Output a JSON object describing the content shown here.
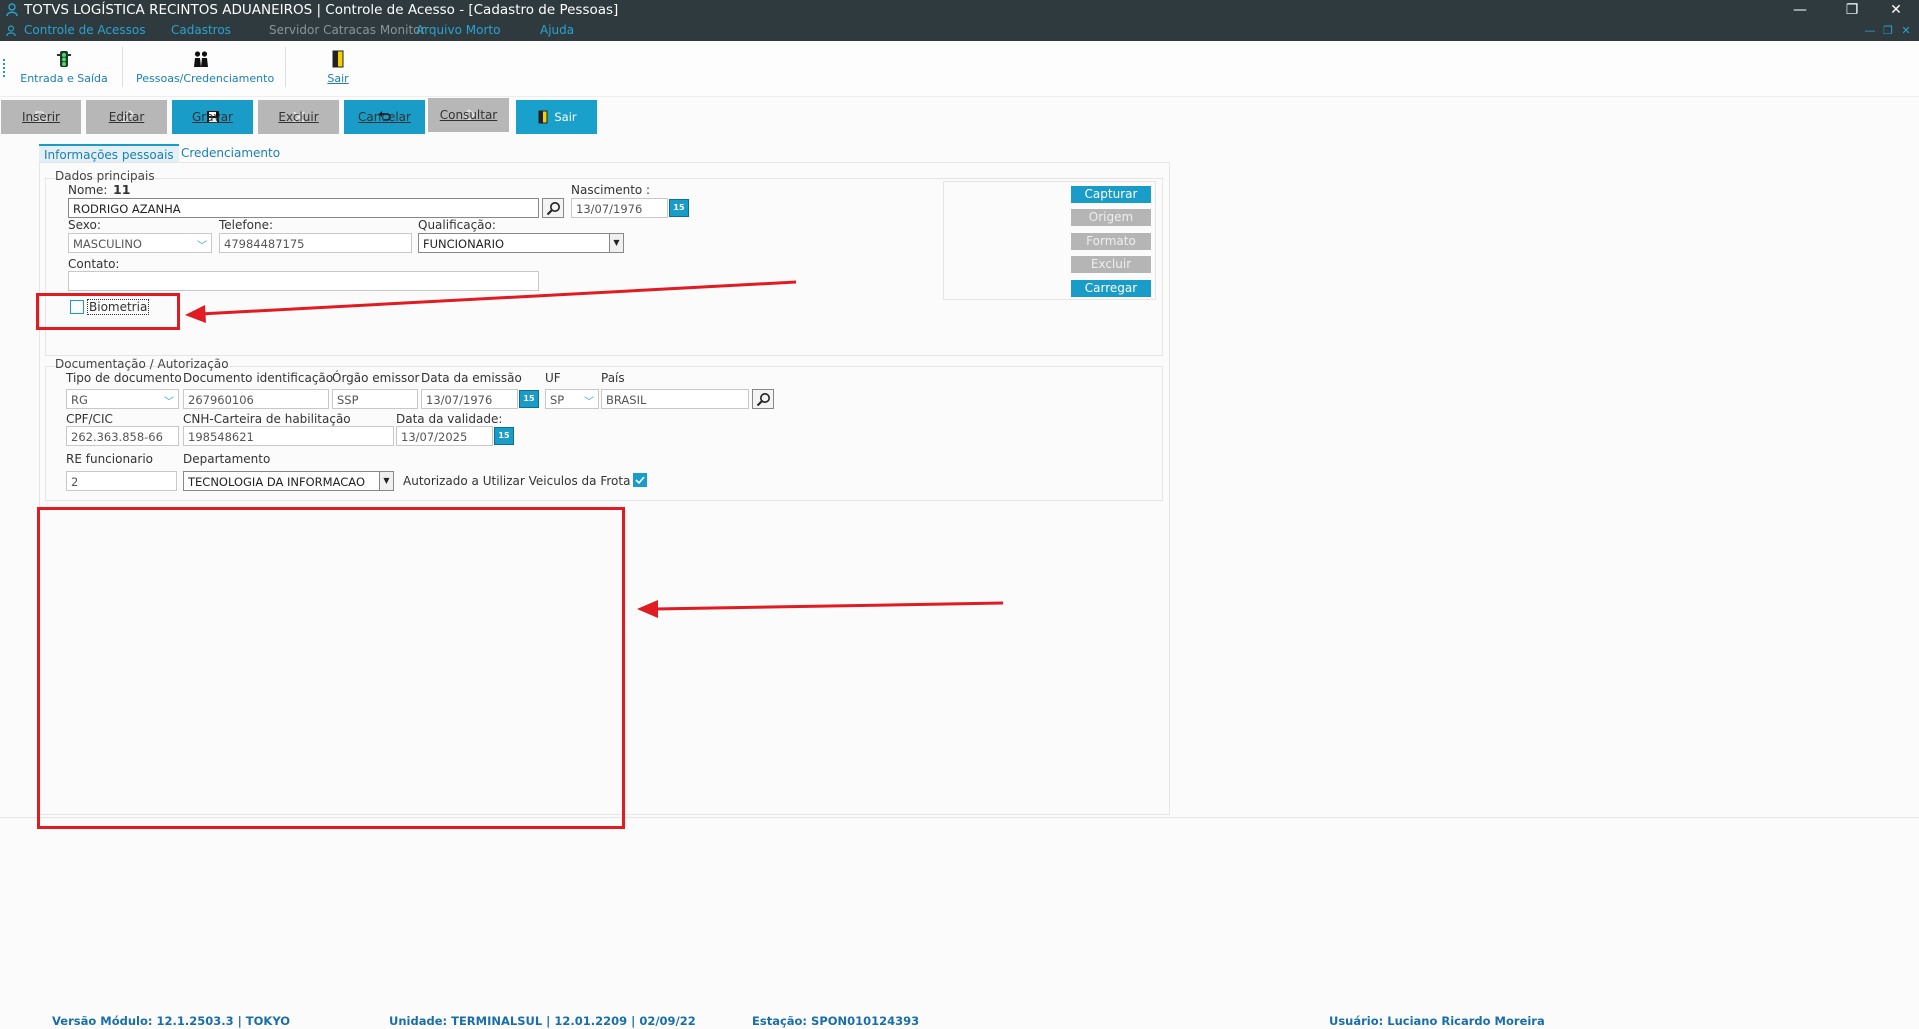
{
  "window": {
    "title": "TOTVS LOGÍSTICA RECINTOS ADUANEIROS | Controle de Acesso - [Cadastro de Pessoas]"
  },
  "menu": {
    "items": [
      "Controle de Acessos",
      "Cadastros",
      "Servidor Catracas Monitor",
      "Arquivo Morto",
      "Ajuda"
    ]
  },
  "quickbar": {
    "entrada": "Entrada e Saída",
    "pessoas": "Pessoas/Credenciamento",
    "sair": "Sair"
  },
  "actions": {
    "inserir": "Inserir",
    "editar": "Editar",
    "gravar": "Gravar",
    "excluir": "Excluir",
    "cancelar": "Cancelar",
    "consultar": "Consultar",
    "sair": "Sair"
  },
  "tabs": {
    "pessoais": "Informações pessoais",
    "credenciamento": "Credenciamento"
  },
  "dados": {
    "group_title": "Dados principais",
    "nome_label": "Nome:",
    "nome_id": "11",
    "nome_value": "RODRIGO AZANHA",
    "nascimento_label": "Nascimento :",
    "nascimento_value": "13/07/1976",
    "sexo_label": "Sexo:",
    "sexo_value": "MASCULINO",
    "telefone_label": "Telefone:",
    "telefone_value": "47984487175",
    "qualificacao_label": "Qualificação:",
    "qualificacao_value": "FUNCIONARIO",
    "contato_label": "Contato:",
    "contato_value": "",
    "biometria_label": "Biometria",
    "biometria_checked": false
  },
  "photo": {
    "capturar": "Capturar",
    "origem": "Origem",
    "formato": "Formato",
    "excluir": "Excluir",
    "carregar": "Carregar"
  },
  "docs": {
    "group_title": "Documentação / Autorização",
    "tipo_label": "Tipo de documento",
    "tipo_value": "RG",
    "docid_label": "Documento identificação",
    "docid_value": "267960106",
    "orgao_label": "Órgão emissor",
    "orgao_value": "SSP",
    "emissao_label": "Data da emissão",
    "emissao_value": "13/07/1976",
    "uf_label": "UF",
    "uf_value": "SP",
    "pais_label": "País",
    "pais_value": "BRASIL",
    "cpf_label": "CPF/CIC",
    "cpf_value": "262.363.858-66",
    "cnh_label": "CNH-Carteira de habilitação",
    "cnh_value": "198548621",
    "validade_label": "Data da validade:",
    "validade_value": "13/07/2025",
    "re_label": "RE funcionario",
    "re_value": "2",
    "depto_label": "Departamento",
    "depto_value": "TECNOLOGIA DA INFORMACAO",
    "frota_label": "Autorizado a Utilizar Veiculos da Frota",
    "frota_checked": true
  },
  "status": {
    "versao": "Versão Módulo:  12.1.2503.3  |  TOKYO",
    "unidade": "Unidade: TERMINALSUL | 12.01.2209 | 02/09/22",
    "estacao": "Estação: SPON010124393",
    "usuario": "Usuário: Luciano Ricardo Moreira"
  },
  "colors": {
    "accent": "#1a9cc8",
    "titlebar": "#2f3a3e",
    "annotation": "#e01b22"
  }
}
